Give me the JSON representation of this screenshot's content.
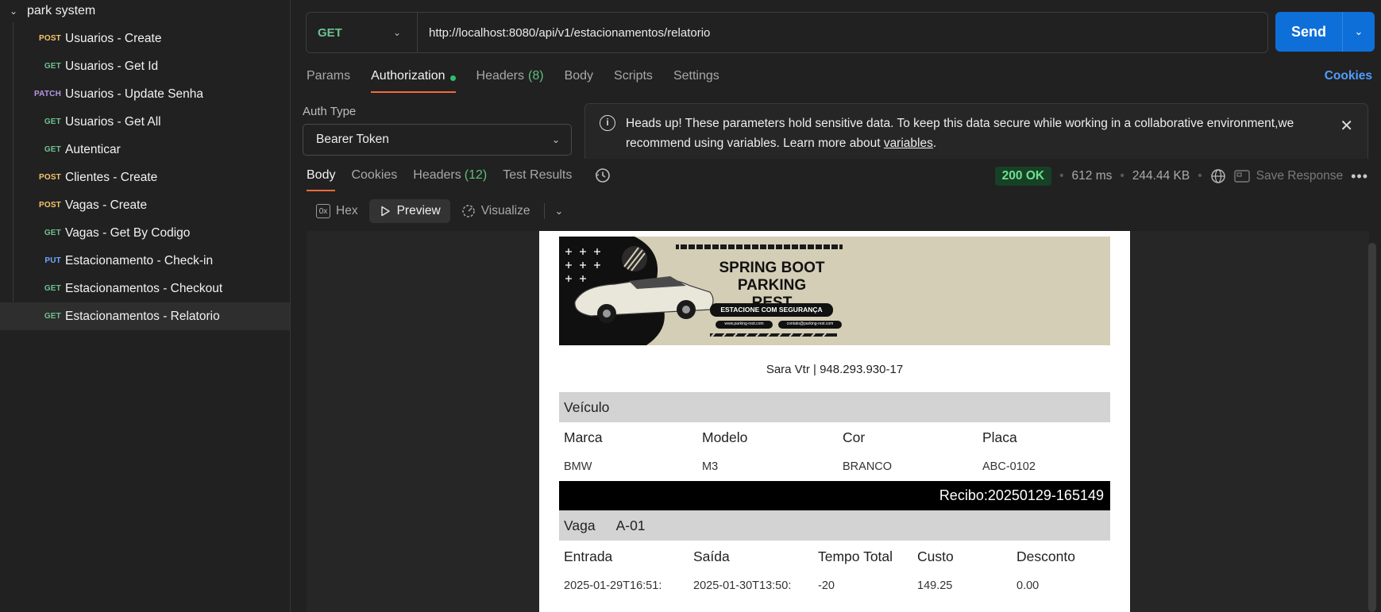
{
  "sidebar": {
    "collection_name": "park system",
    "requests": [
      {
        "method": "POST",
        "name": "Usuarios - Create"
      },
      {
        "method": "GET",
        "name": "Usuarios - Get Id"
      },
      {
        "method": "PATCH",
        "name": "Usuarios - Update Senha"
      },
      {
        "method": "GET",
        "name": "Usuarios - Get All"
      },
      {
        "method": "GET",
        "name": "Autenticar"
      },
      {
        "method": "POST",
        "name": "Clientes - Create"
      },
      {
        "method": "POST",
        "name": "Vagas - Create"
      },
      {
        "method": "GET",
        "name": "Vagas - Get By Codigo"
      },
      {
        "method": "PUT",
        "name": "Estacionamento - Check-in"
      },
      {
        "method": "GET",
        "name": "Estacionamentos - Checkout"
      },
      {
        "method": "GET",
        "name": "Estacionamentos - Relatorio"
      }
    ]
  },
  "request": {
    "method": "GET",
    "url": "http://localhost:8080/api/v1/estacionamentos/relatorio",
    "send_label": "Send",
    "tabs": {
      "params": "Params",
      "authorization": "Authorization",
      "headers": "Headers",
      "headers_count": "(8)",
      "body": "Body",
      "scripts": "Scripts",
      "settings": "Settings"
    },
    "cookies_label": "Cookies"
  },
  "auth": {
    "label": "Auth Type",
    "type": "Bearer Token",
    "notice_text": "Heads up! These parameters hold sensitive data. To keep this data secure while working in a collaborative environment,we recommend using variables. Learn more about ",
    "notice_link": "variables",
    "notice_end": "."
  },
  "response": {
    "tabs": {
      "body": "Body",
      "cookies": "Cookies",
      "headers": "Headers",
      "headers_count": "(12)",
      "test_results": "Test Results"
    },
    "status": "200 OK",
    "time": "612 ms",
    "size": "244.44 KB",
    "save_label": "Save Response",
    "view_tabs": {
      "hex": "Hex",
      "preview": "Preview",
      "visualize": "Visualize"
    }
  },
  "report": {
    "banner": {
      "title_line1": "SPRING BOOT",
      "title_line2": "PARKING REST",
      "tagline": "ESTACIONE COM SEGURANÇA",
      "website": "www.parking-rest.com",
      "email": "contato@parking-rest.com"
    },
    "owner": "Sara Vtr | 948.293.930-17",
    "vehicle_section": "Veículo",
    "vehicle_headers": [
      "Marca",
      "Modelo",
      "Cor",
      "Placa"
    ],
    "vehicle_values": [
      "BMW",
      "M3",
      "BRANCO",
      "ABC-0102"
    ],
    "recibo": "Recibo:20250129-165149",
    "vaga_label": "Vaga",
    "vaga_value": "A-01",
    "stay_headers": [
      "Entrada",
      "Saída",
      "Tempo Total",
      "Custo",
      "Desconto"
    ],
    "stay_values": [
      "2025-01-29T16:51:",
      "2025-01-30T13:50:",
      "-20",
      "149.25",
      "0.00"
    ]
  },
  "colors": {
    "accent_orange": "#f26b3a",
    "send_blue": "#0f6fd8",
    "get_green": "#6cc28f",
    "post_yellow": "#f5c66b",
    "patch_purple": "#b596e6",
    "put_blue": "#6fa8ff"
  }
}
